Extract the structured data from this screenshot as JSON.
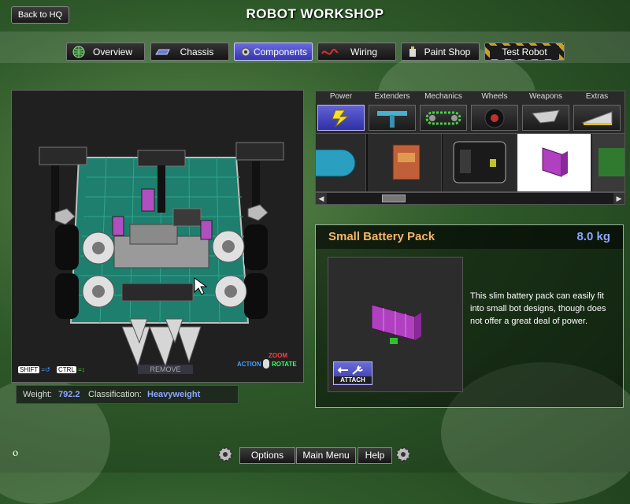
{
  "header": {
    "back_label": "Back to HQ",
    "title": "ROBOT WORKSHOP"
  },
  "nav": {
    "tabs": [
      {
        "label": "Overview",
        "icon": "globe-icon",
        "active": false
      },
      {
        "label": "Chassis",
        "icon": "chassis-icon",
        "active": false
      },
      {
        "label": "Components",
        "icon": "gear-icon",
        "active": true
      },
      {
        "label": "Wiring",
        "icon": "wire-icon",
        "active": false
      },
      {
        "label": "Paint Shop",
        "icon": "paint-icon",
        "active": false
      },
      {
        "label": "Test Robot",
        "icon": "hazard-icon",
        "active": false
      }
    ]
  },
  "viewport": {
    "remove_label": "REMOVE",
    "shift_key": "SHIFT",
    "ctrl_key": "CTRL",
    "action_label": "ACTION",
    "zoom_label": "ZOOM",
    "rotate_label": "ROTATE"
  },
  "stats": {
    "weight_label": "Weight:",
    "weight_value": "792.2",
    "class_label": "Classification:",
    "class_value": "Heavyweight"
  },
  "categories": [
    {
      "label": "Power",
      "icon": "lightning-icon",
      "active": true
    },
    {
      "label": "Extenders",
      "icon": "extender-icon",
      "active": false
    },
    {
      "label": "Mechanics",
      "icon": "chain-icon",
      "active": false
    },
    {
      "label": "Wheels",
      "icon": "wheel-icon",
      "active": false
    },
    {
      "label": "Weapons",
      "icon": "blade-icon",
      "active": false
    },
    {
      "label": "Extras",
      "icon": "wedge-icon",
      "active": false
    }
  ],
  "parts": [
    {
      "icon": "cylinder-battery-icon",
      "selected": false
    },
    {
      "icon": "box-battery-icon",
      "selected": false
    },
    {
      "icon": "large-battery-icon",
      "selected": false
    },
    {
      "icon": "small-battery-icon",
      "selected": true
    },
    {
      "icon": "partial-next-icon",
      "selected": false
    }
  ],
  "detail": {
    "name": "Small Battery Pack",
    "weight": "8.0 kg",
    "description": "This slim battery pack can easily fit into small bot designs, though does not offer a great deal of power.",
    "attach_label": "ATTACH"
  },
  "footer": {
    "options_label": "Options",
    "main_menu_label": "Main Menu",
    "help_label": "Help"
  },
  "colors": {
    "accent": "#4b4bd0",
    "name_color": "#f7b46a",
    "weight_color": "#8ea6ff"
  }
}
